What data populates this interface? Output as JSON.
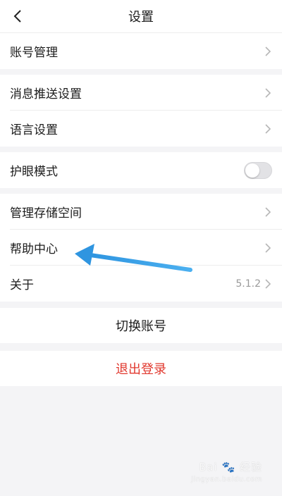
{
  "header": {
    "title": "设置",
    "back_icon": "chevron-left-icon"
  },
  "groups": [
    {
      "items": [
        {
          "label": "账号管理",
          "chevron": true
        }
      ]
    },
    {
      "items": [
        {
          "label": "消息推送设置",
          "chevron": true
        },
        {
          "label": "语言设置",
          "chevron": true
        }
      ]
    },
    {
      "items": [
        {
          "label": "护眼模式",
          "toggle": false
        }
      ]
    },
    {
      "items": [
        {
          "label": "管理存储空间",
          "chevron": true
        },
        {
          "label": "帮助中心",
          "chevron": true
        },
        {
          "label": "关于",
          "value": "5.1.2",
          "chevron": true
        }
      ]
    }
  ],
  "actions": {
    "switch_account": "切换账号",
    "logout": "退出登录"
  },
  "colors": {
    "danger": "#e1382e",
    "annotation_arrow": "#3aa0e8",
    "background": "#f4f4f6"
  },
  "watermark": {
    "brand": "Bai",
    "brand_cn": "经验",
    "url": "jingyan.baidu.com"
  }
}
